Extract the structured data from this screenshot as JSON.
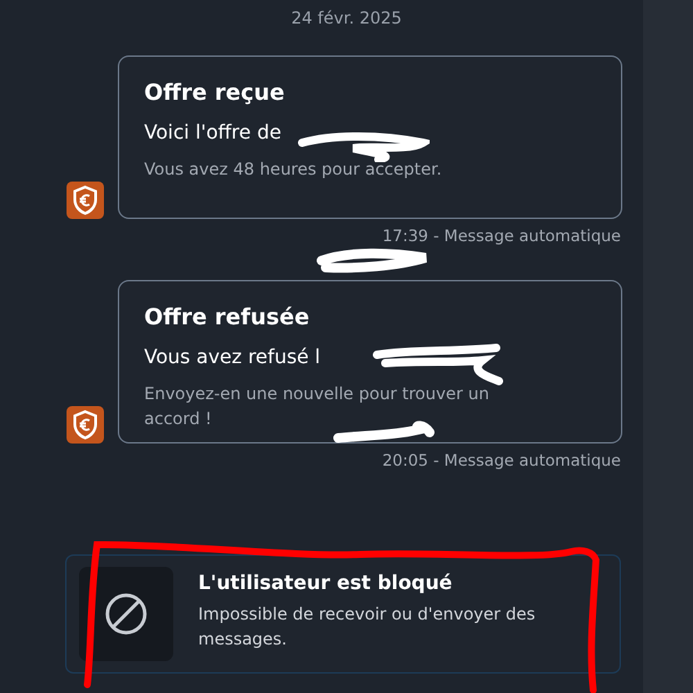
{
  "date": "24 févr. 2025",
  "messages": [
    {
      "title": "Offre reçue",
      "line": "Voici l'offre de",
      "note": "Vous avez 48 heures pour accepter.",
      "meta": "17:39 - Message automatique"
    },
    {
      "title": "Offre refusée",
      "line": "Vous avez refusé l",
      "note": "Envoyez-en une nouvelle pour trouver un accord !",
      "meta": "20:05 - Message automatique"
    }
  ],
  "blocked": {
    "title": "L'utilisateur est bloqué",
    "text": "Impossible de recevoir ou d'envoyer des messages."
  }
}
